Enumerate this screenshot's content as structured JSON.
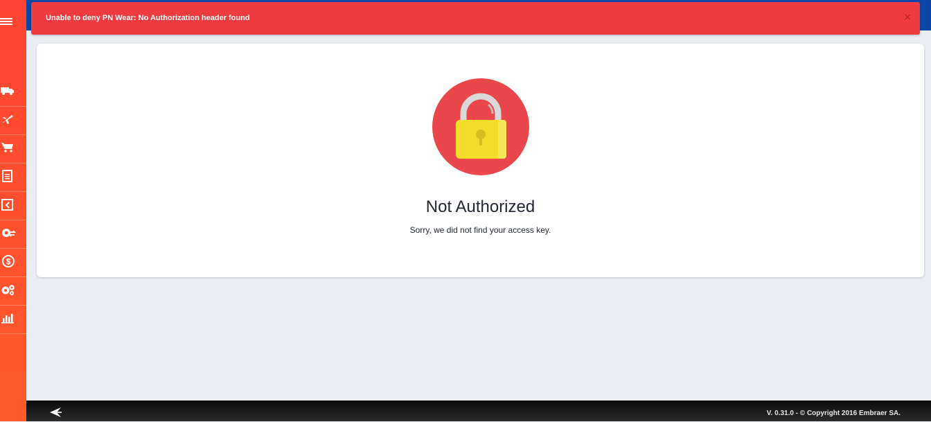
{
  "alert": {
    "message": "Unable to deny PN Wear: No Authorization header found",
    "close_label": "×"
  },
  "sidebar": {
    "items": [
      {
        "icon": "truck-icon"
      },
      {
        "icon": "airplane-icon"
      },
      {
        "icon": "cart-icon"
      },
      {
        "icon": "document-icon"
      },
      {
        "icon": "box-return-icon"
      },
      {
        "icon": "gear-swap-icon"
      },
      {
        "icon": "dollar-cycle-icon"
      },
      {
        "icon": "gears-icon"
      },
      {
        "icon": "bar-chart-icon"
      }
    ]
  },
  "main": {
    "title": "Not Authorized",
    "subtitle": "Sorry, we did not find your access key.",
    "icon": "padlock-icon"
  },
  "footer": {
    "version_text": "V. 0.31.0 -  ©  Copyright 2016 Embraer SA."
  },
  "colors": {
    "sidebar": "#ff4a30",
    "alert": "#ef3b3f",
    "topbar": "#0a47a8",
    "lock_circle": "#e9474b",
    "lock_body": "#f4dc2b"
  }
}
